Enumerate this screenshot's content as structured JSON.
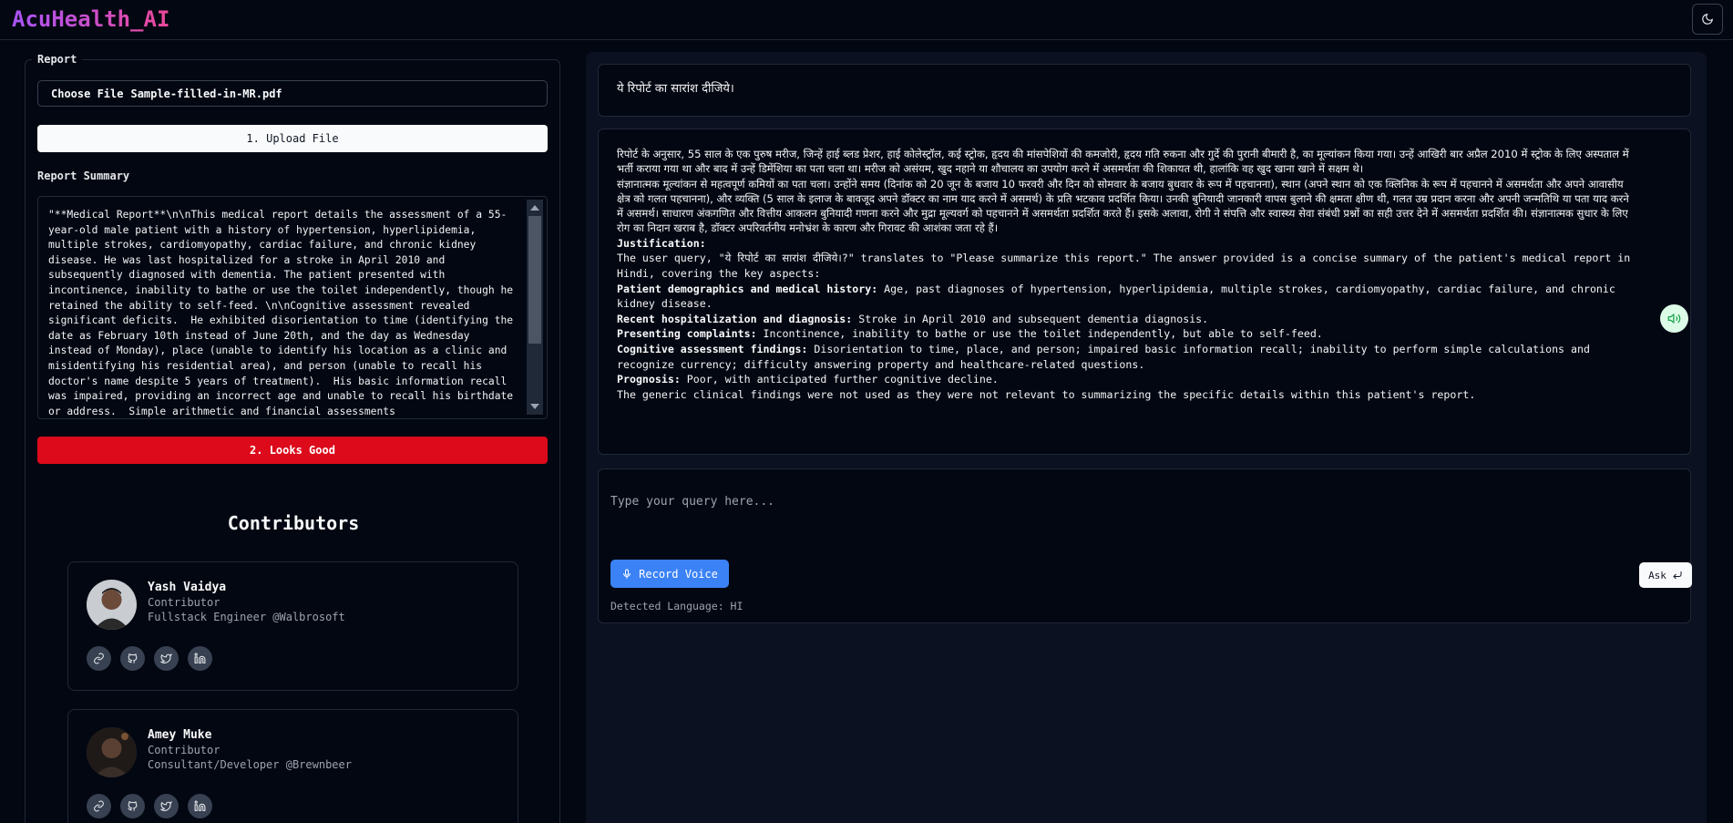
{
  "app": {
    "title": "AcuHealth_AI"
  },
  "report": {
    "section_label": "Report",
    "choose_file_label": "Choose File",
    "file_name": "Sample-filled-in-MR.pdf",
    "upload_button": "1. Upload File",
    "summary_label": "Report Summary",
    "summary_text": "\"**Medical Report**\\n\\nThis medical report details the assessment of a 55-year-old male patient with a history of hypertension, hyperlipidemia, multiple strokes, cardiomyopathy, cardiac failure, and chronic kidney disease. He was last hospitalized for a stroke in April 2010 and subsequently diagnosed with dementia. The patient presented with incontinence, inability to bathe or use the toilet independently, though he retained the ability to self-feed. \\n\\nCognitive assessment revealed significant deficits.  He exhibited disorientation to time (identifying the date as February 10th instead of June 20th, and the day as Wednesday instead of Monday), place (unable to identify his location as a clinic and misidentifying his residential area), and person (unable to recall his doctor's name despite 5 years of treatment).  His basic information recall was impaired, providing an incorrect age and unable to recall his birthdate or address.  Simple arithmetic and financial assessments",
    "looks_good_button": "2. Looks Good"
  },
  "contributors": {
    "title": "Contributors",
    "people": [
      {
        "name": "Yash Vaidya",
        "role": "Contributor",
        "title": "Fullstack Engineer @Walbrosoft"
      },
      {
        "name": "Amey Muke",
        "role": "Contributor",
        "title": "Consultant/Developer @Brewnbeer"
      }
    ]
  },
  "chat": {
    "user_query": "ये रिपोर्ट का सारांश दीजिये।",
    "answer": {
      "hindi_p1": "रिपोर्ट के अनुसार, 55 साल के एक पुरुष मरीज, जिन्हें हाई ब्लड प्रेशर, हाई कोलेस्ट्रॉल, कई स्ट्रोक, हृदय की मांसपेशियों की कमजोरी, हृदय गति रुकना और गुर्दे की पुरानी बीमारी है, का मूल्यांकन किया गया। उन्हें आखिरी बार अप्रैल 2010 में स्ट्रोक के लिए अस्पताल में भर्ती कराया गया था और बाद में उन्हें डिमेंशिया का पता चला था। मरीज को असंयम, खुद नहाने या शौचालय का उपयोग करने में असमर्थता की शिकायत थी, हालांकि वह खुद खाना खाने में सक्षम थे।",
      "hindi_p2": "संज्ञानात्मक मूल्यांकन से महत्वपूर्ण कमियों का पता चला। उन्होंने समय (दिनांक को 20 जून के बजाय 10 फरवरी और दिन को सोमवार के बजाय बुधवार के रूप में पहचानना), स्थान (अपने स्थान को एक क्लिनिक के रूप में पहचानने में असमर्थता और अपने आवासीय क्षेत्र को गलत पहचानना), और व्यक्ति (5 साल के इलाज के बावजूद अपने डॉक्टर का नाम याद करने में असमर्थ) के प्रति भटकाव प्रदर्शित किया। उनकी बुनियादी जानकारी वापस बुलाने की क्षमता क्षीण थी, गलत उम्र प्रदान करना और अपनी जन्मतिथि या पता याद करने में असमर्थ। साधारण अंकगणित और वित्तीय आकलन बुनियादी गणना करने और मुद्रा मूल्यवर्ग को पहचानने में असमर्थता प्रदर्शित करते हैं। इसके अलावा, रोगी ने संपत्ति और स्वास्थ्य सेवा संबंधी प्रश्नों का सही उत्तर देने में असमर्थता प्रदर्शित की। संज्ञानात्मक सुधार के लिए रोग का निदान खराब है, डॉक्टर अपरिवर्तनीय मनोभ्रंश के कारण और गिरावट की आशंका जता रहे हैं।",
      "justification_label": "Justification:",
      "justification_text": "The user query, \"ये रिपोर्ट का सारांश दीजिये।?\" translates to \"Please summarize this report.\" The answer provided is a concise summary of the patient's medical report in Hindi, covering the key aspects:",
      "items": [
        {
          "label": "Patient demographics and medical history:",
          "text": " Age, past diagnoses of hypertension, hyperlipidemia, multiple strokes, cardiomyopathy, cardiac failure, and chronic kidney disease."
        },
        {
          "label": "Recent hospitalization and diagnosis:",
          "text": " Stroke in April 2010 and subsequent dementia diagnosis."
        },
        {
          "label": "Presenting complaints:",
          "text": " Incontinence, inability to bathe or use the toilet independently, but able to self-feed."
        },
        {
          "label": "Cognitive assessment findings:",
          "text": " Disorientation to time, place, and person; impaired basic information recall; inability to perform simple calculations and recognize currency; difficulty answering property and healthcare-related questions."
        },
        {
          "label": "Prognosis:",
          "text": " Poor, with anticipated further cognitive decline."
        }
      ],
      "closing": "The generic clinical findings were not used as they were not relevant to summarizing the specific details within this patient's report."
    },
    "input_placeholder": "Type your query here...",
    "record_button": "Record Voice",
    "ask_button": "Ask",
    "detected_language": "Detected Language: HI"
  }
}
